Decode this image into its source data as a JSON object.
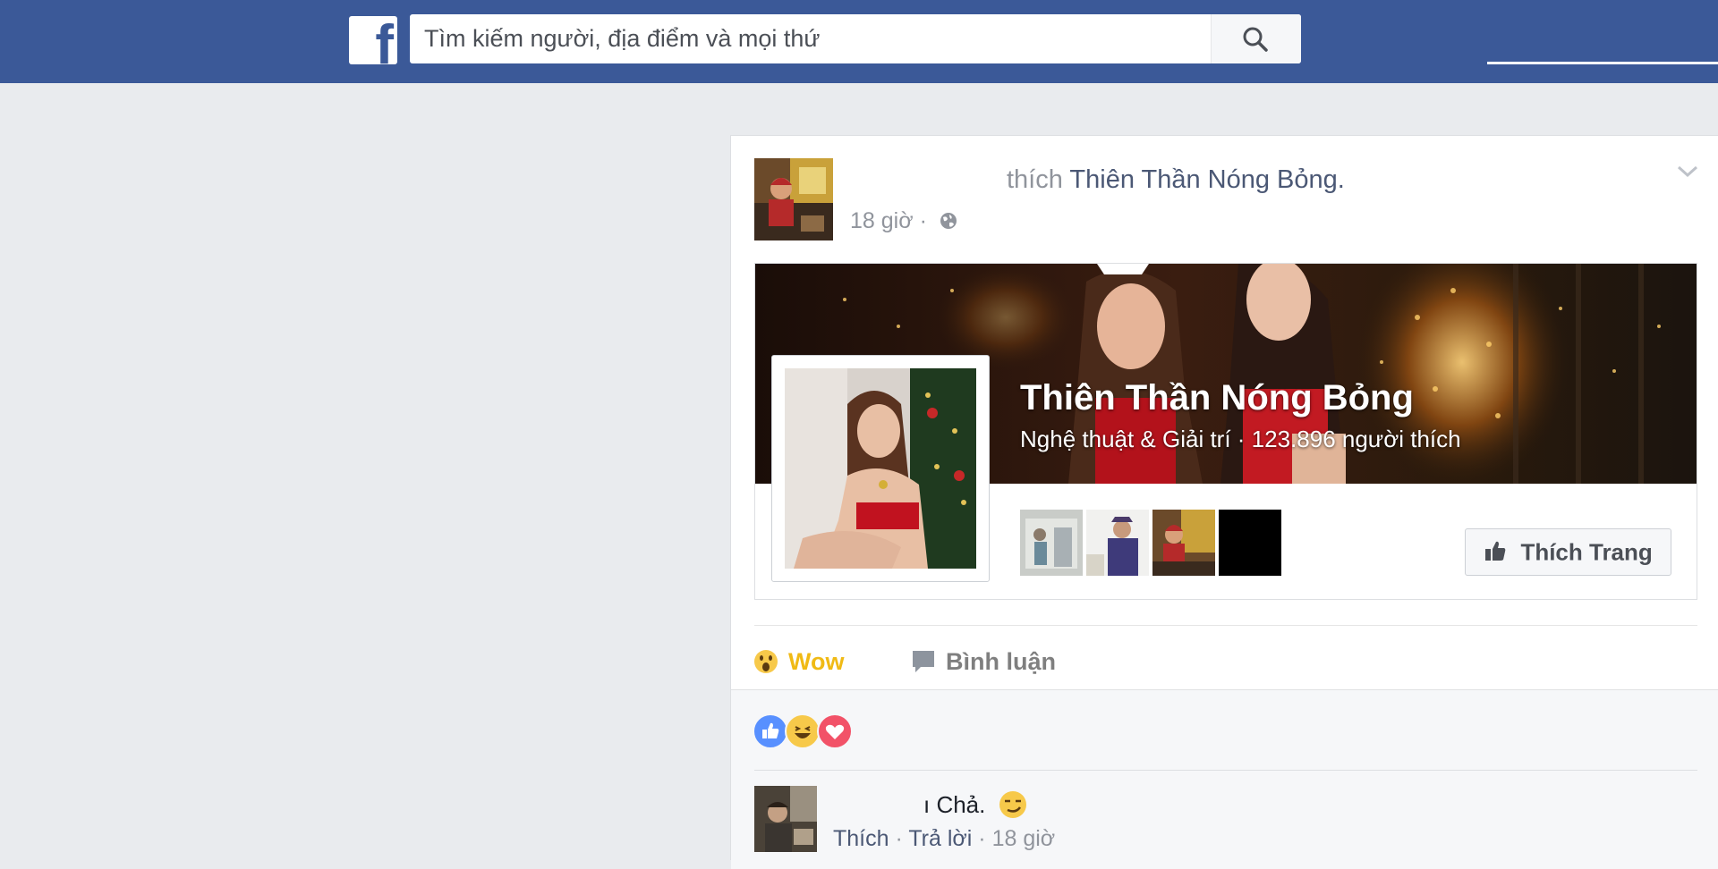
{
  "header": {
    "logo_letter": "f",
    "search_placeholder": "Tìm kiếm người, địa điểm và mọi thứ"
  },
  "post": {
    "headline_verb": "thích",
    "headline_page": "Thiên Thần Nóng Bỏng.",
    "time": "18 giờ",
    "separator": "·",
    "page_card": {
      "name": "Thiên Thần Nóng Bỏng",
      "subtitle": "Nghệ thuật & Giải trí · 123.896 người thích",
      "like_button": "Thích Trang"
    },
    "actions": {
      "wow": "Wow",
      "comment": "Bình luận"
    }
  },
  "comment": {
    "text": "ı Chả.",
    "like": "Thích",
    "reply": "Trả lời",
    "time": "18 giờ",
    "dot": "·"
  },
  "colors": {
    "brand_blue": "#3b5998",
    "wow_yellow": "#f0ba15",
    "like_blue": "#5890ff",
    "love_red": "#f25268"
  }
}
